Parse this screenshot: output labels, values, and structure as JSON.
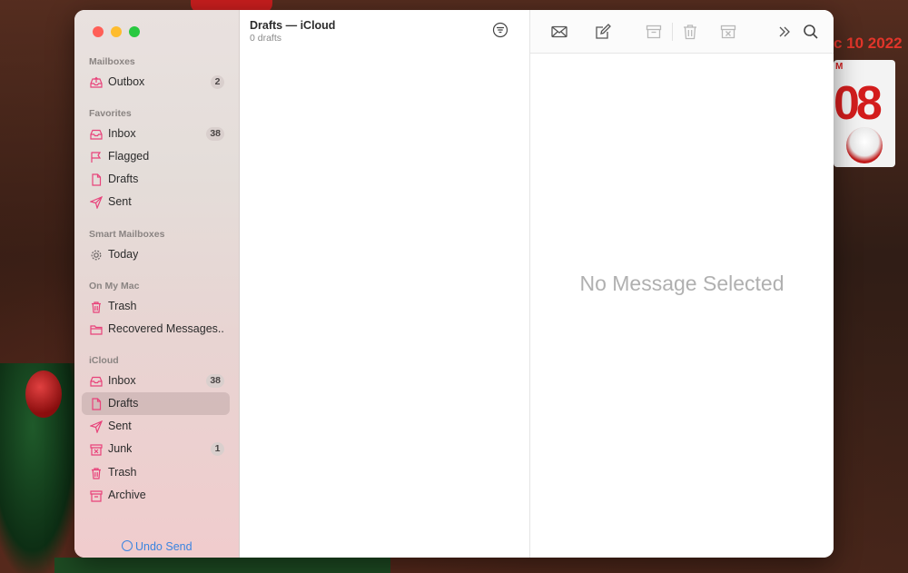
{
  "background": {
    "date_text": "c 10 2022",
    "calendar_digits": "08",
    "calendar_tag": "M"
  },
  "colors": {
    "accent_pink": "#e8427a",
    "link_blue": "#3a84e0",
    "traffic_red": "#ff5f57",
    "traffic_yellow": "#febc2e",
    "traffic_green": "#28c840"
  },
  "sidebar": {
    "sections": {
      "mailboxes": "Mailboxes",
      "favorites": "Favorites",
      "smart": "Smart Mailboxes",
      "on_my_mac": "On My Mac",
      "icloud": "iCloud"
    },
    "items": [
      {
        "label": "Outbox",
        "badge": "2",
        "icon": "outbox-icon"
      },
      {
        "label": "Inbox",
        "badge": "38",
        "icon": "inbox-icon"
      },
      {
        "label": "Flagged",
        "icon": "flag-icon"
      },
      {
        "label": "Drafts",
        "icon": "document-icon"
      },
      {
        "label": "Sent",
        "icon": "paper-plane-icon"
      },
      {
        "label": "Today",
        "icon": "gear-icon"
      },
      {
        "label": "Trash",
        "icon": "trash-icon"
      },
      {
        "label": "Recovered Messages...",
        "icon": "folder-icon"
      },
      {
        "label": "Inbox",
        "badge": "38",
        "icon": "inbox-icon"
      },
      {
        "label": "Drafts",
        "icon": "document-icon",
        "selected": true
      },
      {
        "label": "Sent",
        "icon": "paper-plane-icon"
      },
      {
        "label": "Junk",
        "badge": "1",
        "icon": "junk-icon"
      },
      {
        "label": "Trash",
        "icon": "trash-icon"
      },
      {
        "label": "Archive",
        "icon": "archive-icon"
      }
    ],
    "undo_send": "Undo Send"
  },
  "message_list": {
    "title": "Drafts — iCloud",
    "subtitle": "0 drafts"
  },
  "toolbar": {
    "icons": [
      "envelope-icon",
      "compose-icon",
      "archive-icon",
      "trash-icon",
      "junk-icon",
      "chevron-double-right-icon",
      "search-icon"
    ]
  },
  "viewer": {
    "empty_text": "No Message Selected"
  }
}
